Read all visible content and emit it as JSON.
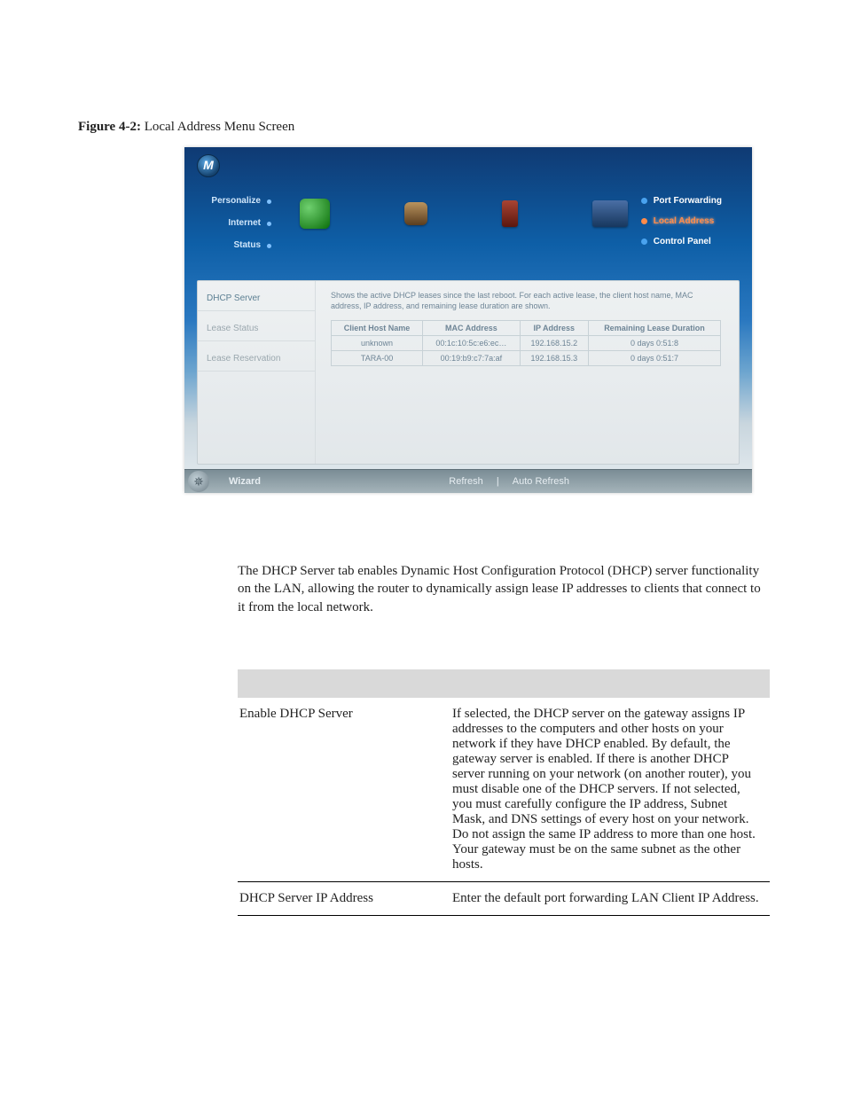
{
  "figure": {
    "label": "Figure 4-2:",
    "title": " Local Address Menu Screen"
  },
  "logo": "M",
  "left_nav": {
    "items": [
      "Personalize",
      "Internet",
      "Status"
    ]
  },
  "right_nav": {
    "items": [
      {
        "label": "Port Forwarding",
        "selected": false
      },
      {
        "label": "Local Address",
        "selected": true
      },
      {
        "label": "Control Panel",
        "selected": false
      }
    ]
  },
  "side_tabs": {
    "items": [
      "DHCP Server",
      "Lease Status",
      "Lease Reservation"
    ],
    "selected_index": 0
  },
  "panel": {
    "description": "Shows the active DHCP leases since the last reboot. For each active lease, the client host name, MAC address, IP address, and remaining lease duration are shown.",
    "headers": [
      "Client Host Name",
      "MAC Address",
      "IP Address",
      "Remaining Lease Duration"
    ],
    "rows": [
      [
        "unknown",
        "00:1c:10:5c:e6:ec…",
        "192.168.15.2",
        "0 days 0:51:8"
      ],
      [
        "TARA-00",
        "00:19:b9:c7:7a:af",
        "192.168.15.3",
        "0 days 0:51:7"
      ]
    ]
  },
  "bottom": {
    "wizard": "Wizard",
    "refresh": "Refresh",
    "auto": "Auto Refresh"
  },
  "body_para": "The DHCP Server tab enables Dynamic Host Configuration Protocol (DHCP) server functionality on the LAN, allowing the router to dynamically assign lease IP addresses to clients that connect to it from the local network.",
  "params": [
    {
      "label": "Enable DHCP Server",
      "desc": "If selected, the DHCP server on the gateway assigns IP addresses to the computers and other hosts on your network if they have DHCP enabled. By default, the gateway server is enabled. If there is another DHCP server running on your network (on another router), you must disable one of the DHCP servers. If not selected, you must carefully configure the IP address, Subnet Mask, and DNS settings of every host on your network. Do not assign the same IP address to more than one host. Your gateway must be on the same subnet as the other hosts."
    },
    {
      "label": "DHCP Server IP Address",
      "desc": "Enter the default port forwarding LAN Client IP Address."
    }
  ]
}
